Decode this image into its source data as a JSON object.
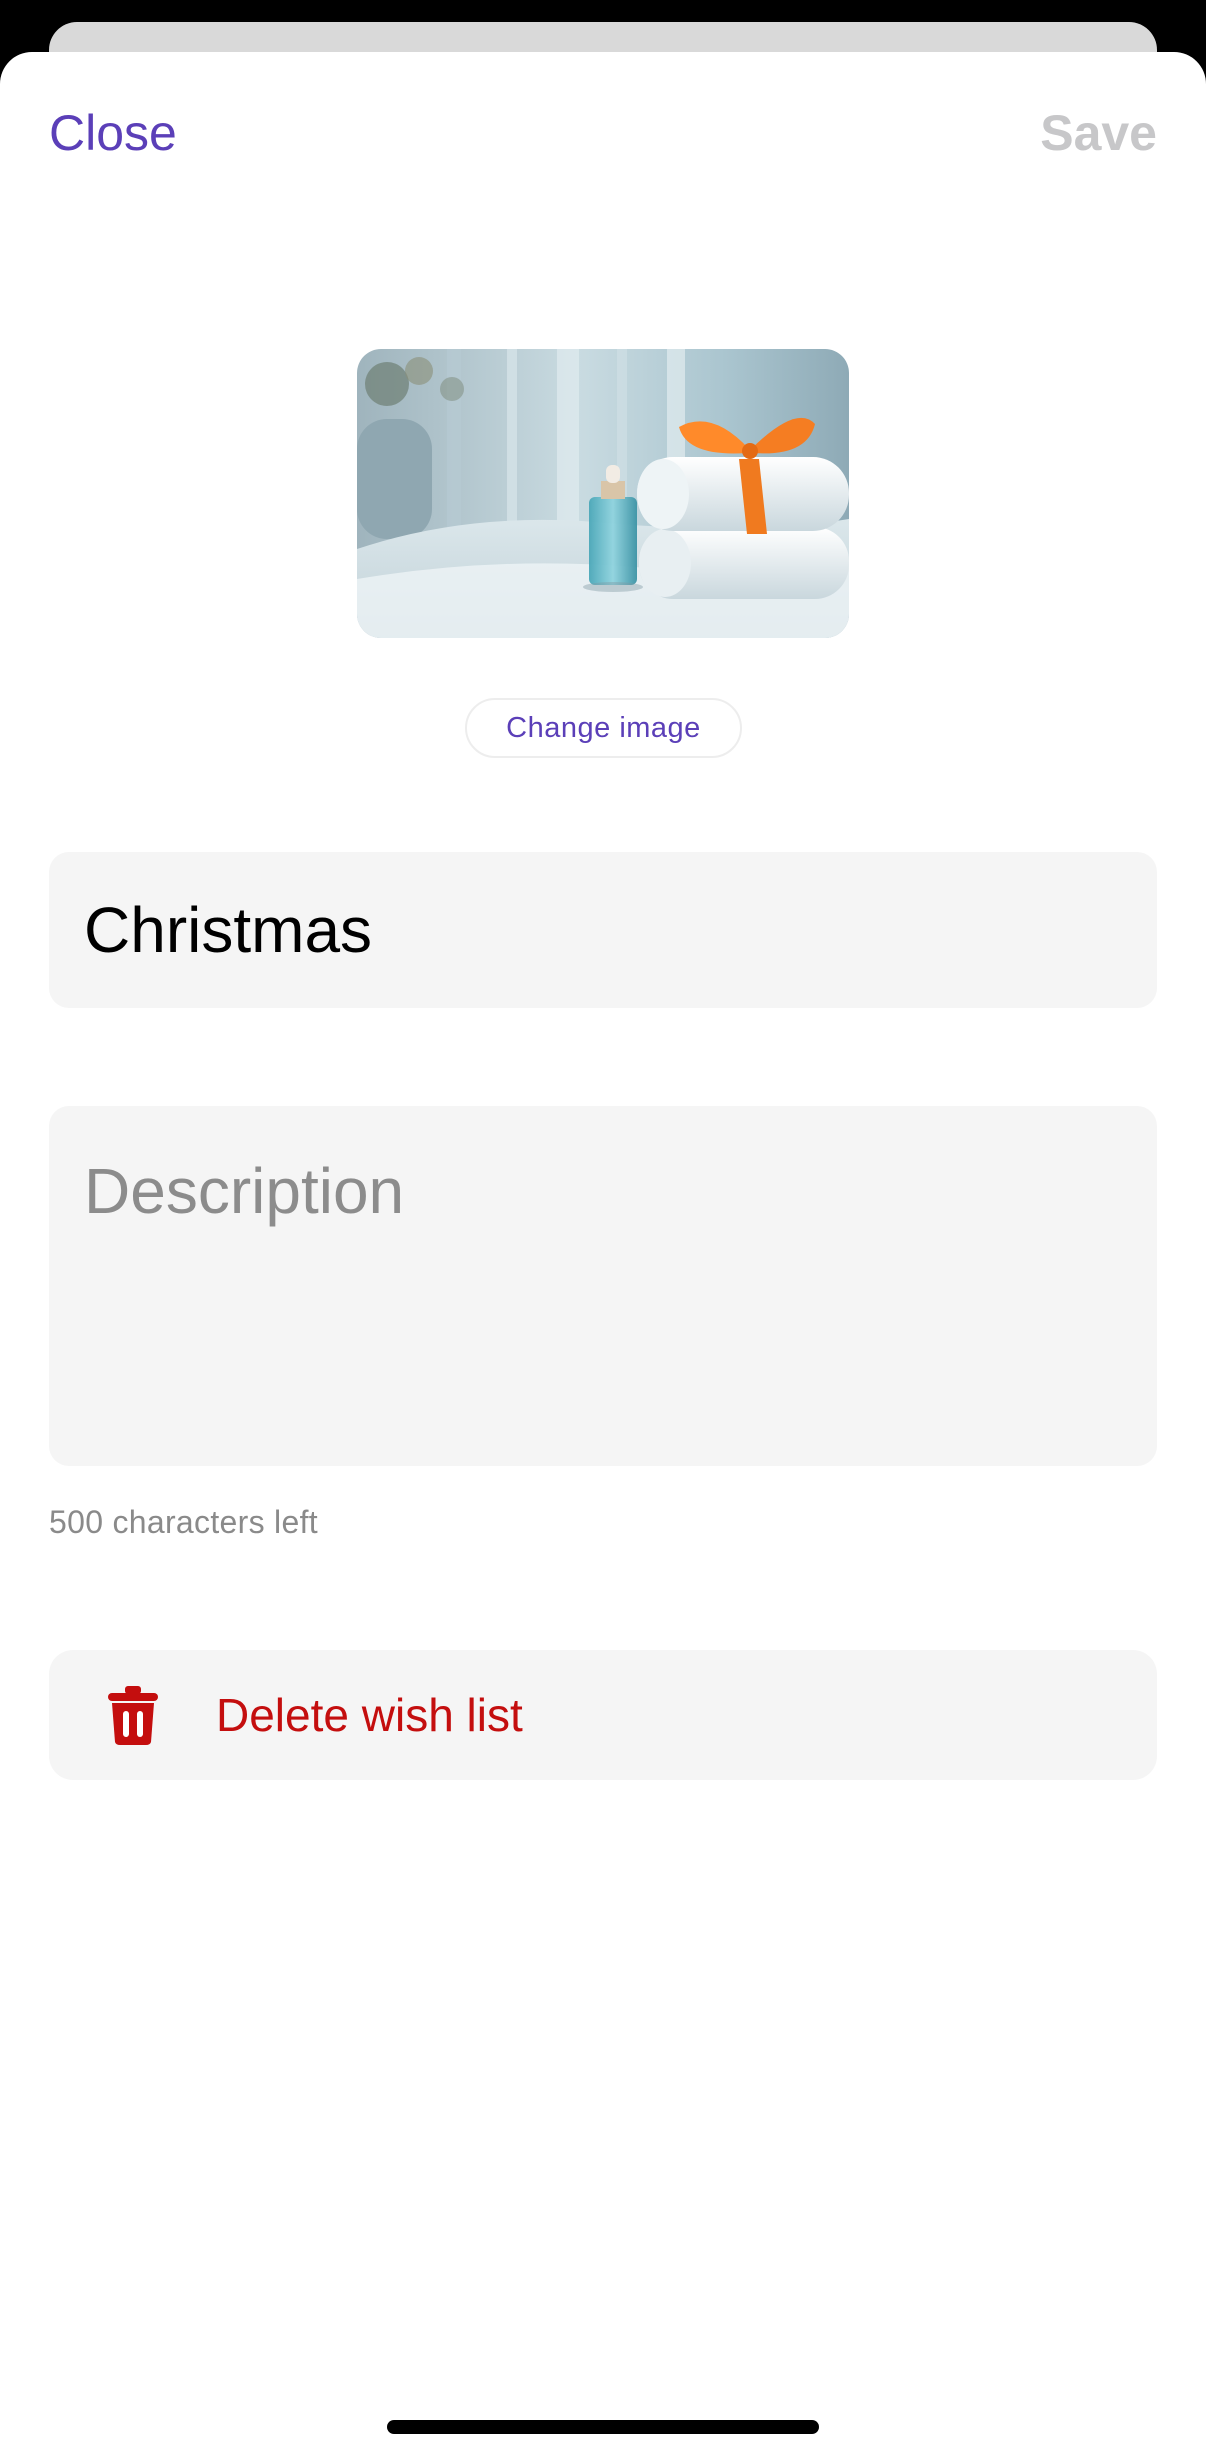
{
  "header": {
    "close_label": "Close",
    "save_label": "Save"
  },
  "image": {
    "change_label": "Change image"
  },
  "form": {
    "name_value": "Christmas",
    "description_placeholder": "Description",
    "chars_left": "500 characters left"
  },
  "actions": {
    "delete_label": "Delete wish list",
    "delete_icon": "trash-icon"
  },
  "colors": {
    "accent": "#5b3fb8",
    "destructive": "#c40e0e",
    "disabled": "#c7c7c9",
    "field_background": "#f5f5f5"
  }
}
